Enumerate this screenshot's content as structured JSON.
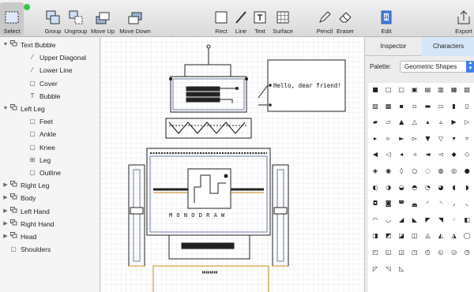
{
  "window": {
    "traffic_lights": [
      {
        "name": "close",
        "color": "#fc605c"
      },
      {
        "name": "minimize",
        "color": "#fdbc40"
      },
      {
        "name": "zoom",
        "color": "#34c84a"
      }
    ]
  },
  "toolbar": {
    "select": "Select",
    "group": "Group",
    "ungroup": "Ungroup",
    "move_up": "Move Up",
    "move_down": "Move Down",
    "rect": "Rect",
    "line": "Line",
    "text": "Text",
    "surface": "Surface",
    "pencil": "Pencil",
    "eraser": "Eraser",
    "edit": "Edit",
    "export": "Export"
  },
  "sidebar": {
    "items": [
      {
        "label": "Text Bubble",
        "icon": "group-icon",
        "expanded": true,
        "level": 0
      },
      {
        "label": "Upper Diagonal",
        "icon": "line-icon",
        "level": 1
      },
      {
        "label": "Lower Line",
        "icon": "line-icon",
        "level": 1
      },
      {
        "label": "Cover",
        "icon": "rect-icon",
        "level": 1
      },
      {
        "label": "Bubble",
        "icon": "text-icon",
        "level": 1
      },
      {
        "label": "Left Leg",
        "icon": "group-icon",
        "expanded": true,
        "level": 0
      },
      {
        "label": "Feet",
        "icon": "rect-icon",
        "level": 1
      },
      {
        "label": "Ankle",
        "icon": "rect-icon",
        "level": 1
      },
      {
        "label": "Knee",
        "icon": "rect-icon",
        "level": 1
      },
      {
        "label": "Leg",
        "icon": "surface-icon",
        "level": 1
      },
      {
        "label": "Outline",
        "icon": "rect-icon",
        "level": 1
      },
      {
        "label": "Right Leg",
        "icon": "group-icon",
        "expanded": false,
        "level": 0
      },
      {
        "label": "Body",
        "icon": "group-icon",
        "expanded": false,
        "level": 0
      },
      {
        "label": "Left Hand",
        "icon": "group-icon",
        "expanded": false,
        "level": 0
      },
      {
        "label": "Right Hand",
        "icon": "group-icon",
        "expanded": false,
        "level": 0
      },
      {
        "label": "Head",
        "icon": "group-icon",
        "expanded": false,
        "level": 0
      },
      {
        "label": "Shoulders",
        "icon": "rect-icon",
        "level": 0
      }
    ]
  },
  "canvas": {
    "bubble_text": "Hello, dear friend!",
    "chest_text": "M O N O D R A W"
  },
  "panel": {
    "tabs": [
      "Inspector",
      "Characters"
    ],
    "active_tab": "Characters",
    "palette_label": "Palette:",
    "palette_value": "Geometric Shapes",
    "characters": [
      "■",
      "□",
      "▢",
      "▣",
      "▤",
      "▥",
      "▦",
      "▧",
      "▨",
      "▩",
      "▪",
      "▫",
      "▬",
      "▭",
      "▮",
      "▯",
      "▰",
      "▱",
      "▲",
      "△",
      "▴",
      "▵",
      "▶",
      "▷",
      "▸",
      "▹",
      "►",
      "▻",
      "▼",
      "▽",
      "▾",
      "▿",
      "◀",
      "◁",
      "◂",
      "◃",
      "◄",
      "◅",
      "◆",
      "◇",
      "◈",
      "◉",
      "◊",
      "○",
      "◌",
      "◍",
      "◎",
      "●",
      "◐",
      "◑",
      "◒",
      "◓",
      "◔",
      "◕",
      "◖",
      "◗",
      "◘",
      "◙",
      "◚",
      "◛",
      "◜",
      "◝",
      "◞",
      "◟",
      "◠",
      "◡",
      "◢",
      "◣",
      "◤",
      "◥",
      "◦",
      "◧",
      "◨",
      "◩",
      "◪",
      "◫",
      "◬",
      "◭",
      "◮",
      "◯",
      "◰",
      "◱",
      "◲",
      "◳",
      "◴",
      "◵",
      "◶",
      "◷",
      "◸",
      "◹",
      "◺"
    ]
  }
}
